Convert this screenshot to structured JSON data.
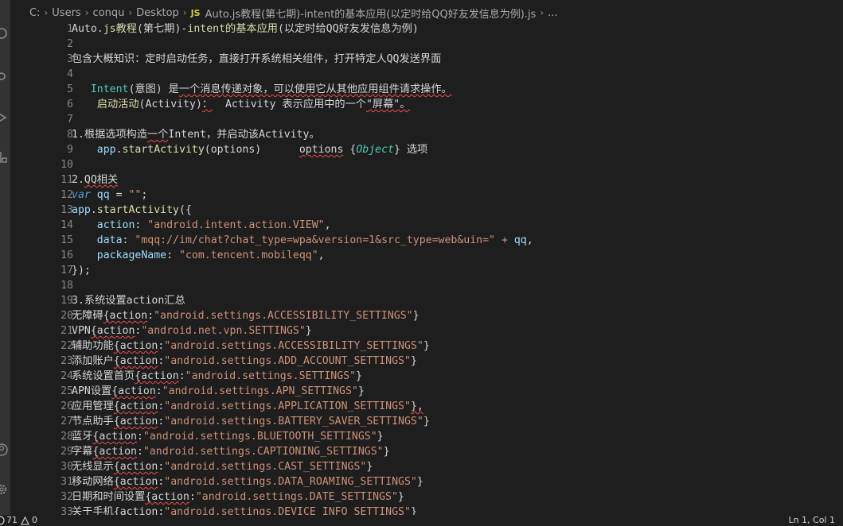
{
  "breadcrumb": {
    "segments": [
      "C:",
      "Users",
      "conqu",
      "Desktop"
    ],
    "file_badge": "JS",
    "file_name": "Auto.js教程(第七期)-intent的基本应用(以定时给QQ好友发信息为例).js",
    "more": "..."
  },
  "editor": {
    "lines": [
      {
        "n": "1",
        "seg": [
          [
            "t-txt",
            "Auto."
          ],
          [
            "t-fn",
            "js教程"
          ],
          [
            "t-txt",
            "(第七期)"
          ],
          [
            "t-op",
            "-"
          ],
          [
            "t-fn",
            "intent的基本应用"
          ],
          [
            "t-txt",
            "(以定时给QQ好友发信息为例)"
          ]
        ]
      },
      {
        "n": "2",
        "seg": []
      },
      {
        "n": "3",
        "seg": [
          [
            "t-txt",
            "包含大概知识：定时启动任务，直接打开系统相关组件，打开特定人QQ发送界面"
          ]
        ]
      },
      {
        "n": "4",
        "seg": []
      },
      {
        "n": "5",
        "seg": [
          [
            "t-txt",
            "   "
          ],
          [
            "t-teal",
            "Intent"
          ],
          [
            "t-txt",
            "(意图) 是"
          ],
          [
            "t-sq",
            "一个消息传递对象，可以使用它从其他应用组件请求操作。"
          ]
        ]
      },
      {
        "n": "6",
        "seg": [
          [
            "t-txt",
            "    "
          ],
          [
            "t-fn",
            "启动活动"
          ],
          [
            "t-txt",
            "(Activity)"
          ],
          [
            "t-sq",
            "："
          ],
          [
            "t-txt",
            "  Activity 表示应用中的一个"
          ],
          [
            "t-sq",
            "\"屏幕\"。"
          ]
        ]
      },
      {
        "n": "7",
        "seg": []
      },
      {
        "n": "8",
        "seg": [
          [
            "t-txt",
            "1.根据选项构造"
          ],
          [
            "t-sq",
            "一个"
          ],
          [
            "t-txt",
            "Intent，并启动该Activity。"
          ]
        ]
      },
      {
        "n": "9",
        "seg": [
          [
            "t-txt",
            "    "
          ],
          [
            "t-var",
            "app"
          ],
          [
            "t-txt",
            "."
          ],
          [
            "t-fn",
            "startActivity"
          ],
          [
            "t-txt",
            "(options)      "
          ],
          [
            "t-sq",
            "options"
          ],
          [
            "t-txt",
            " {"
          ],
          [
            "t-type",
            "Object"
          ],
          [
            "t-txt",
            "} 选项"
          ]
        ]
      },
      {
        "n": "10",
        "seg": []
      },
      {
        "n": "11",
        "seg": [
          [
            "t-txt",
            "2."
          ],
          [
            "t-sq",
            "QQ相关"
          ]
        ]
      },
      {
        "n": "12",
        "seg": [
          [
            "t-kw",
            "var"
          ],
          [
            "t-txt",
            " "
          ],
          [
            "t-var",
            "qq"
          ],
          [
            "t-txt",
            " "
          ],
          [
            "t-op",
            "="
          ],
          [
            "t-txt",
            " "
          ],
          [
            "t-str",
            "\"\""
          ],
          [
            "t-txt",
            ";"
          ]
        ]
      },
      {
        "n": "13",
        "seg": [
          [
            "t-var",
            "app"
          ],
          [
            "t-txt",
            "."
          ],
          [
            "t-fn",
            "startActivity"
          ],
          [
            "t-txt",
            "({"
          ]
        ]
      },
      {
        "n": "14",
        "seg": [
          [
            "t-txt",
            "    "
          ],
          [
            "t-var",
            "action"
          ],
          [
            "t-txt",
            ": "
          ],
          [
            "t-str",
            "\"android.intent.action.VIEW\""
          ],
          [
            "t-txt",
            ","
          ]
        ]
      },
      {
        "n": "15",
        "seg": [
          [
            "t-txt",
            "    "
          ],
          [
            "t-var",
            "data"
          ],
          [
            "t-txt",
            ": "
          ],
          [
            "t-str",
            "\"mqq://im/chat?chat_type=wpa&version=1&src_type=web&uin=\""
          ],
          [
            "t-txt",
            " "
          ],
          [
            "t-str",
            "+"
          ],
          [
            "t-txt",
            " "
          ],
          [
            "t-var",
            "qq"
          ],
          [
            "t-txt",
            ","
          ]
        ]
      },
      {
        "n": "16",
        "seg": [
          [
            "t-txt",
            "    "
          ],
          [
            "t-var",
            "packageName"
          ],
          [
            "t-txt",
            ": "
          ],
          [
            "t-str",
            "\"com.tencent.mobileqq\""
          ],
          [
            "t-txt",
            ","
          ]
        ]
      },
      {
        "n": "17",
        "seg": [
          [
            "t-txt",
            "});"
          ]
        ]
      },
      {
        "n": "18",
        "seg": []
      },
      {
        "n": "19",
        "seg": [
          [
            "t-txt",
            "3.系统设置action汇总"
          ]
        ]
      },
      {
        "n": "20",
        "seg": [
          [
            "t-txt",
            "无障碍"
          ],
          [
            "t-sq",
            "{action"
          ],
          [
            "t-txt",
            ":"
          ],
          [
            "t-str",
            "\"android.settings.ACCESSIBILITY_SETTINGS\""
          ],
          [
            "t-txt",
            "}"
          ]
        ]
      },
      {
        "n": "21",
        "seg": [
          [
            "t-txt",
            "VPN"
          ],
          [
            "t-sq",
            "{action"
          ],
          [
            "t-txt",
            ":"
          ],
          [
            "t-str",
            "\"android.net.vpn.SETTINGS\""
          ],
          [
            "t-txt",
            "}"
          ]
        ]
      },
      {
        "n": "22",
        "seg": [
          [
            "t-txt",
            "辅助功能"
          ],
          [
            "t-sq",
            "{action"
          ],
          [
            "t-txt",
            ":"
          ],
          [
            "t-str",
            "\"android.settings.ACCESSIBILITY_SETTINGS\""
          ],
          [
            "t-txt",
            "}"
          ]
        ]
      },
      {
        "n": "23",
        "seg": [
          [
            "t-txt",
            "添加账户"
          ],
          [
            "t-sq",
            "{action"
          ],
          [
            "t-txt",
            ":"
          ],
          [
            "t-str",
            "\"android.settings.ADD_ACCOUNT_SETTINGS\""
          ],
          [
            "t-txt",
            "}"
          ]
        ]
      },
      {
        "n": "24",
        "seg": [
          [
            "t-txt",
            "系统设置首页"
          ],
          [
            "t-sq",
            "{action"
          ],
          [
            "t-txt",
            ":"
          ],
          [
            "t-str",
            "\"android.settings.SETTINGS\""
          ],
          [
            "t-txt",
            "}"
          ]
        ]
      },
      {
        "n": "25",
        "seg": [
          [
            "t-txt",
            "APN设置"
          ],
          [
            "t-sq",
            "{action"
          ],
          [
            "t-txt",
            ":"
          ],
          [
            "t-str",
            "\"android.settings.APN_SETTINGS\""
          ],
          [
            "t-txt",
            "}"
          ]
        ]
      },
      {
        "n": "26",
        "seg": [
          [
            "t-txt",
            "应用管理"
          ],
          [
            "t-sq",
            "{action"
          ],
          [
            "t-txt",
            ":"
          ],
          [
            "t-str",
            "\"android.settings.APPLICATION_SETTINGS\""
          ],
          [
            "t-sq",
            "},"
          ]
        ]
      },
      {
        "n": "27",
        "seg": [
          [
            "t-txt",
            "节点助手"
          ],
          [
            "t-sq",
            "{action"
          ],
          [
            "t-txt",
            ":"
          ],
          [
            "t-str",
            "\"android.settings.BATTERY_SAVER_SETTINGS\""
          ],
          [
            "t-txt",
            "}"
          ]
        ]
      },
      {
        "n": "28",
        "seg": [
          [
            "t-txt",
            "蓝牙"
          ],
          [
            "t-sq",
            "{action"
          ],
          [
            "t-txt",
            ":"
          ],
          [
            "t-str",
            "\"android.settings.BLUETOOTH_SETTINGS\""
          ],
          [
            "t-txt",
            "}"
          ]
        ]
      },
      {
        "n": "29",
        "seg": [
          [
            "t-txt",
            "字幕"
          ],
          [
            "t-sq",
            "{action"
          ],
          [
            "t-txt",
            ":"
          ],
          [
            "t-str",
            "\"android.settings.CAPTIONING_SETTINGS\""
          ],
          [
            "t-txt",
            "}"
          ]
        ]
      },
      {
        "n": "30",
        "seg": [
          [
            "t-txt",
            "无线显示"
          ],
          [
            "t-sq",
            "{action"
          ],
          [
            "t-txt",
            ":"
          ],
          [
            "t-str",
            "\"android.settings.CAST_SETTINGS\""
          ],
          [
            "t-txt",
            "}"
          ]
        ]
      },
      {
        "n": "31",
        "seg": [
          [
            "t-txt",
            "移动网络"
          ],
          [
            "t-sq",
            "{action"
          ],
          [
            "t-txt",
            ":"
          ],
          [
            "t-str",
            "\"android.settings.DATA_ROAMING_SETTINGS\""
          ],
          [
            "t-txt",
            "}"
          ]
        ]
      },
      {
        "n": "32",
        "seg": [
          [
            "t-txt",
            "日期和时间设置"
          ],
          [
            "t-sq",
            "{action"
          ],
          [
            "t-txt",
            ":"
          ],
          [
            "t-str",
            "\"android.settings.DATE_SETTINGS\""
          ],
          [
            "t-txt",
            "}"
          ]
        ]
      },
      {
        "n": "33",
        "seg": [
          [
            "t-txt",
            "关于手机"
          ],
          [
            "t-sq",
            "{action"
          ],
          [
            "t-txt",
            ":"
          ],
          [
            "t-str",
            "\"android.settings.DEVICE_INFO_SETTINGS\""
          ],
          [
            "t-txt",
            "}"
          ]
        ]
      }
    ]
  },
  "statusbar": {
    "errors": "71",
    "warnings": "0",
    "position": "Ln 1, Col 1"
  },
  "activity_bar": {
    "icons": [
      "search-icon",
      "source-control-icon",
      "run-debug-icon",
      "extensions-icon",
      "account-icon",
      "settings-gear-icon"
    ]
  },
  "colors": {
    "editor_bg": "#1e1e1e",
    "activity_bg": "#333333",
    "squiggle": "#f14c4c",
    "keyword": "#569cd6",
    "function": "#dcdcaa",
    "string": "#ce9178",
    "variable": "#9cdcfe",
    "type": "#4ec9b0"
  }
}
